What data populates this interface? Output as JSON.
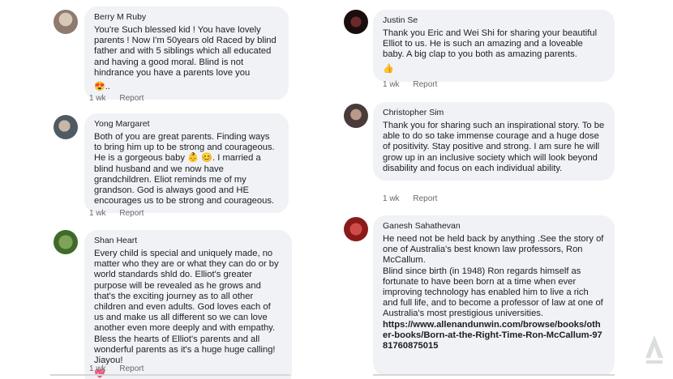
{
  "comments_left": [
    {
      "author": "Berry M Ruby",
      "text": "You're Such blessed kid ! You have lovely parents ! Now I'm 50years old Raced by blind father and with 5 siblings which all educated and having a good moral. Blind is not hindrance you have a parents love you",
      "emoji": "😍..",
      "time": "1 wk",
      "report": "Report"
    },
    {
      "author": "Yong Margaret",
      "text": "Both of you are great parents. Finding ways to bring him up to be strong and courageous. He is a gorgeous baby 👶 😊. I married a blind husband and we now have grandchildren. Eliot reminds me of my grandson. God is always good and HE encourages us to be strong and courageous.",
      "time": "1 wk",
      "report": "Report"
    },
    {
      "author": "Shan Heart",
      "text": "Every child is special and uniquely made, no matter who they are or what they can do or by world standards shld do. Elliot's greater purpose will be revealed as he grows and that's the exciting journey as to all other children and even adults. God loves each of us and make us all different so we can love another even more deeply and with empathy. Bless the hearts of Elliot's parents and all wonderful parents as it's a huge huge calling! Jiayou!",
      "emoji": "💖",
      "time": "1 wk",
      "report": "Report"
    }
  ],
  "comments_right": [
    {
      "author": "Justin Se",
      "text": "Thank you Eric and Wei Shi for sharing your beautiful Elliot to us. He is such an amazing and a loveable baby. A big clap to you both as amazing parents.",
      "emoji": "👍",
      "time": "1 wk",
      "report": "Report"
    },
    {
      "author": "Christopher Sim",
      "text": "Thank you for sharing such an inspirational story. To be able to do so take immense courage and a huge dose of positivity. Stay positive and strong. I am sure he will grow up in an inclusive society which will look beyond disability and focus on each individual ability.",
      "time": "1 wk",
      "report": "Report"
    },
    {
      "author": "Ganesh Sahathevan",
      "text": "He need not be held back by anything .See the story of one of Australia's best known law professors, Ron McCallum.\nBlind since birth (in 1948) Ron regards himself as fortunate to have been born at a time when ever improving technology has enabled him to live a rich and full life, and to become a professor of law at one of Australia's most prestigious universities.",
      "link": "https://www.allenandunwin.com/browse/books/other-books/Born-at-the-Right-Time-Ron-McCallum-9781760875015"
    }
  ],
  "colors": {
    "bubble": "#f0f2f5",
    "meta": "#65676b",
    "text": "#1c1e21"
  }
}
